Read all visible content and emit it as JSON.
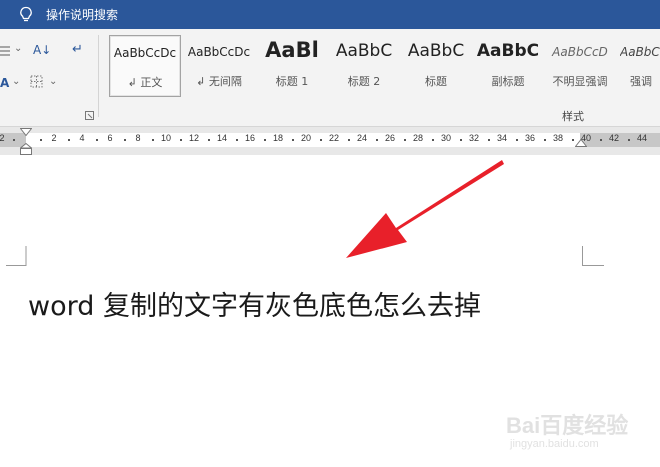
{
  "tellme": {
    "label": "操作说明搜索",
    "icon": "lightbulb-icon"
  },
  "paragraph_group": {
    "sort_glyph": "A↓",
    "pilcrow_glyph": "↵"
  },
  "styles": {
    "group_label": "样式",
    "items": [
      {
        "sample": "AaBbCcDc",
        "name": "↲ 正文",
        "selected": true
      },
      {
        "sample": "AaBbCcDc",
        "name": "↲ 无间隔",
        "selected": false
      },
      {
        "sample": "AaBl",
        "name": "标题 1",
        "selected": false
      },
      {
        "sample": "AaBbC",
        "name": "标题 2",
        "selected": false
      },
      {
        "sample": "AaBbC",
        "name": "标题",
        "selected": false
      },
      {
        "sample": "AaBbC",
        "name": "副标题",
        "selected": false
      },
      {
        "sample": "AaBbCcD",
        "name": "不明显强调",
        "selected": false
      },
      {
        "sample": "AaBbCcD",
        "name": "强调",
        "selected": false
      }
    ]
  },
  "ruler": {
    "ticks": [
      "2",
      "2",
      "4",
      "6",
      "8",
      "10",
      "12",
      "14",
      "16",
      "18",
      "20",
      "22",
      "24",
      "26",
      "28",
      "30",
      "32",
      "34",
      "36",
      "38",
      "40",
      "42",
      "44"
    ]
  },
  "document": {
    "text": "word 复制的文字有灰色底色怎么去掉"
  },
  "annotation": {
    "color": "#e8202a"
  },
  "watermark": {
    "logo": "Bai百度经验",
    "url": "jingyan.baidu.com"
  },
  "colors": {
    "titlebar": "#2b579a",
    "ribbon": "#f3f3f3"
  }
}
